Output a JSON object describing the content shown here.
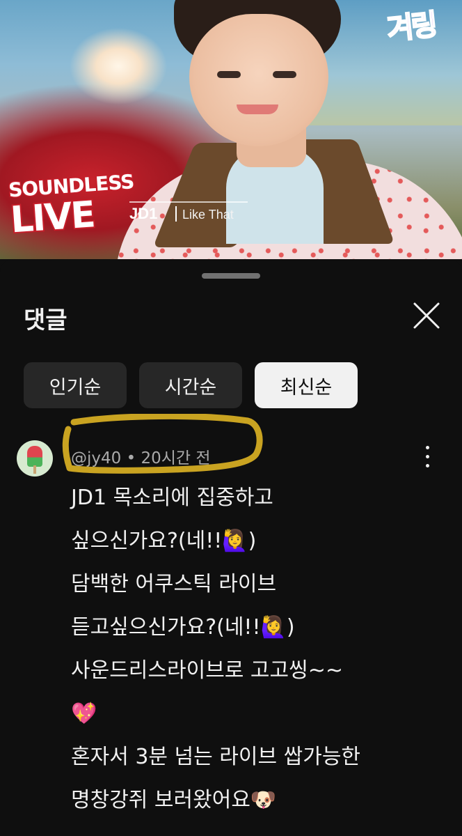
{
  "video": {
    "brand_line1": "SOUNDLESS",
    "brand_line2": "LIVE",
    "artist": "JD1",
    "song": "Like That",
    "channel_logo": "겨링"
  },
  "comments_panel": {
    "title": "댓글",
    "sort_chips": [
      {
        "label": "인기순",
        "selected": false
      },
      {
        "label": "시간순",
        "selected": false
      },
      {
        "label": "최신순",
        "selected": true
      }
    ]
  },
  "comment": {
    "author": "@jy40",
    "separator": "•",
    "time": "20시간 전",
    "lines": [
      "JD1 목소리에 집중하고",
      "싶으신가요?(네!!🙋‍♀️)",
      "담백한 어쿠스틱 라이브",
      "듣고싶으신가요?(네!!🙋‍♀️)",
      "사운드리스라이브로 고고씽~~",
      "💖",
      "혼자서 3분 넘는 라이브 쌉가능한",
      "명창강쥐 보러왔어요🐶"
    ]
  },
  "colors": {
    "sheet_bg": "#0f0f0f",
    "chip_bg": "#272727",
    "chip_selected_bg": "#f1f1f1",
    "highlighter": "#c9a321"
  },
  "icons": {
    "close": "close-icon",
    "more": "more-vert-icon"
  }
}
